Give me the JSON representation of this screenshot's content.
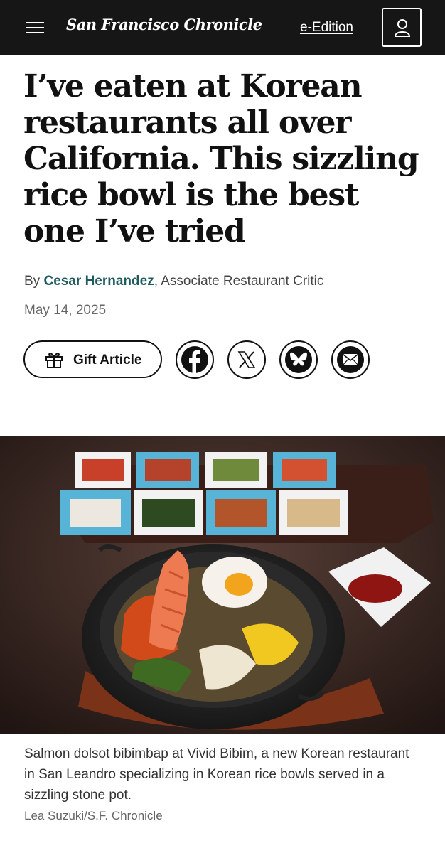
{
  "header": {
    "logo": "San Francisco Chronicle",
    "eedition_label": "e-Edition"
  },
  "article": {
    "headline": "I’ve eaten at Korean restaurants all over California. This sizzling rice bowl is the best one I’ve tried",
    "byline_prefix": "By",
    "author": "Cesar Hernandez",
    "byline_separator": ",",
    "author_role": "Associate Restaurant Critic",
    "date": "May 14, 2025"
  },
  "share": {
    "gift_label": "Gift Article",
    "icons": [
      "gift-icon",
      "facebook-icon",
      "x-icon",
      "bluesky-icon",
      "email-icon"
    ]
  },
  "photo": {
    "caption": "Salmon dolsot bibimbap at Vivid Bibim, a new Korean restaurant in San Leandro specializing in Korean rice bowls served in a sizzling stone pot.",
    "credit": "Lea Suzuki/S.F. Chronicle"
  },
  "colors": {
    "header_bg": "#161616",
    "author_link": "#1f5a5f"
  }
}
